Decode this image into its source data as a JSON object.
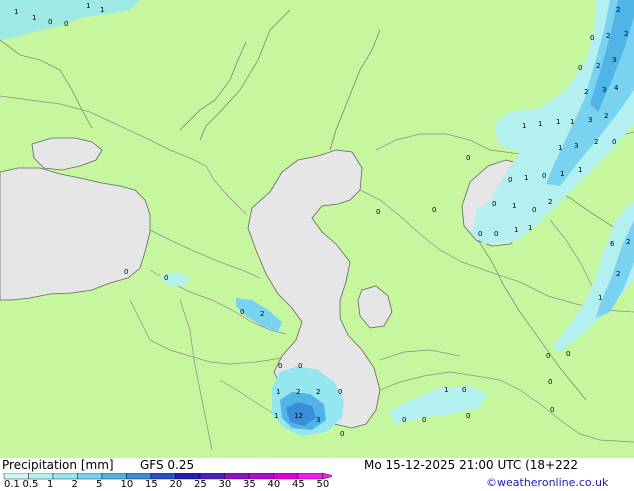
{
  "product_title": "Precipitation [mm]",
  "model": "GFS 0.25",
  "valid_time": "Mo 15-12-2025 21:00 UTC (18+222",
  "credit": "©weatheronline.co.uk",
  "legend": {
    "ticks": [
      "0.1",
      "0.5",
      "1",
      "2",
      "5",
      "10",
      "15",
      "20",
      "25",
      "30",
      "35",
      "40",
      "45",
      "50"
    ],
    "colors": [
      "#d2f5f5",
      "#b4f0f0",
      "#96e6f0",
      "#78d2f0",
      "#50b4e6",
      "#3c8cdc",
      "#2850c8",
      "#1e1eb4",
      "#501ebe",
      "#8c14c8",
      "#b40ad2",
      "#dc00dc",
      "#f01ef0"
    ]
  },
  "colors": {
    "land": "#c6f79e",
    "water": "#e6e6e6",
    "border": "#8c8c8c",
    "coast": "#646464"
  },
  "map_values": [
    "1",
    "1",
    "0",
    "1",
    "1",
    "0",
    "2",
    "0",
    "2",
    "2",
    "3",
    "0",
    "2",
    "4",
    "3",
    "2",
    "1",
    "1",
    "1",
    "1",
    "3",
    "2",
    "1",
    "3",
    "2",
    "0",
    "1",
    "1",
    "0",
    "2",
    "1",
    "0",
    "0",
    "1",
    "0",
    "1",
    "0",
    "0",
    "0",
    "1",
    "0",
    "0",
    "6",
    "2",
    "1",
    "2",
    "0",
    "0",
    "2",
    "0",
    "0",
    "1",
    "2",
    "2",
    "0",
    "0",
    "1",
    "12",
    "3",
    "0",
    "1",
    "0",
    "0",
    "0",
    "0",
    "0",
    "0",
    "0",
    "0"
  ]
}
